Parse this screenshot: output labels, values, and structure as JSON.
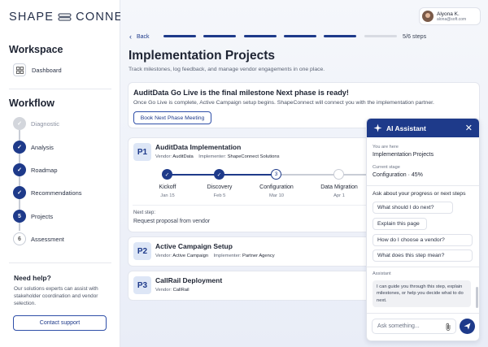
{
  "brand": {
    "logo_left": "SHAPE",
    "logo_right": "CONNECT"
  },
  "sidebar": {
    "workspace_title": "Workspace",
    "dashboard_label": "Dashboard",
    "workflow_title": "Workflow",
    "steps": [
      {
        "num": "✓",
        "label": "Diagnostic",
        "state": "faded"
      },
      {
        "num": "✓",
        "label": "Analysis",
        "state": "done"
      },
      {
        "num": "✓",
        "label": "Roadmap",
        "state": "done"
      },
      {
        "num": "✓",
        "label": "Recommendations",
        "state": "done"
      },
      {
        "num": "5",
        "label": "Projects",
        "state": "current"
      },
      {
        "num": "6",
        "label": "Assessment",
        "state": "todo"
      }
    ],
    "help_title": "Need help?",
    "help_text": "Our solutions experts can assist with stakeholder coordination and vendor selection.",
    "contact_label": "Contact support"
  },
  "header": {
    "back_label": "Back",
    "progress": {
      "completed": 5,
      "total": 6
    },
    "steps_count": "5/6 steps",
    "user_name": "Alyona K.",
    "user_email": "alona@soft.com"
  },
  "page": {
    "title": "Implementation Projects",
    "subtitle": "Track milestones, log feedback, and manage vendor engagements in one place."
  },
  "banner": {
    "title": "AuditData Go Live is the final milestone  Next phase is ready!",
    "text": "Once Go Live is complete, Active Campaign setup begins. ShapeConnect will connect you with the implementation partner.",
    "button_label": "Book Next Phase Meeting"
  },
  "projects": [
    {
      "badge": "P1",
      "title": "AuditData Implementation",
      "vendor_label": "Vendor:",
      "vendor": "AuditData",
      "implementer_label": "Implementer:",
      "implementer": "ShapeConnect Solutions",
      "milestones": [
        {
          "label": "Kickoff",
          "date": "Jan 15",
          "state": "done"
        },
        {
          "label": "Discovery",
          "date": "Feb 5",
          "state": "done"
        },
        {
          "label": "Configuration",
          "date": "Mar 10",
          "state": "current",
          "num": "3"
        },
        {
          "label": "Data Migration",
          "date": "Apr 1",
          "state": "todo"
        }
      ],
      "next_step_label": "Next step:",
      "next_step": "Request proposal from vendor"
    },
    {
      "badge": "P2",
      "title": "Active Campaign Setup",
      "vendor_label": "Vendor:",
      "vendor": "Active Campaign",
      "implementer_label": "Implementer:",
      "implementer": "Partner Agency"
    },
    {
      "badge": "P3",
      "title": "CallRail Deployment",
      "vendor_label": "Vendor:",
      "vendor": "CallRail"
    }
  ],
  "assistant": {
    "title": "AI Assistant",
    "close_label": "✕",
    "you_are_here_label": "You are here",
    "you_are_here": "Implementation Projects",
    "stage_label": "Current stage",
    "stage": "Configuration · 45%",
    "ask_label": "Ask about your progress or next steps",
    "suggestions": [
      "What should I do next?",
      "Explain this page",
      "How do I choose a vendor?",
      "What does this step mean?"
    ],
    "role_label": "Assistant",
    "message": "I can guide you through this step, explain milestones, or help you decide what to do next.",
    "input_placeholder": "Ask something..."
  },
  "colors": {
    "accent": "#1e3a8a",
    "progress_inactive": "#d8dbe2"
  }
}
